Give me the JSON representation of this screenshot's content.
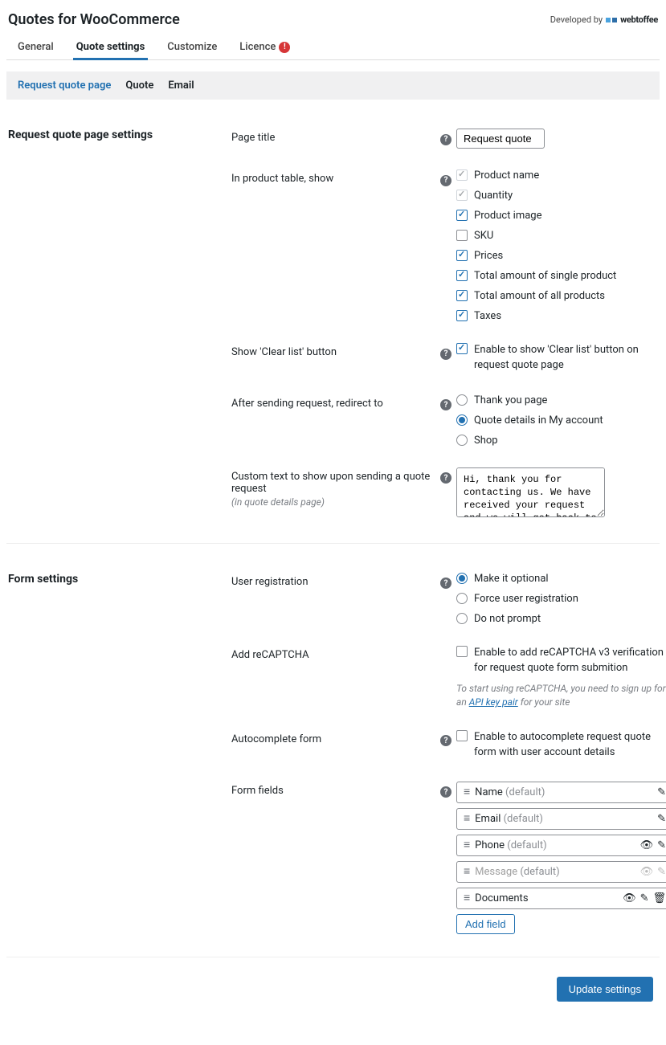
{
  "header": {
    "title": "Quotes for WooCommerce",
    "developed_by": "Developed by",
    "brand": "webtoffee"
  },
  "tabs": [
    {
      "label": "General",
      "active": false
    },
    {
      "label": "Quote settings",
      "active": true
    },
    {
      "label": "Customize",
      "active": false
    },
    {
      "label": "Licence",
      "active": false,
      "alert": "!"
    }
  ],
  "subtabs": [
    {
      "label": "Request quote page",
      "active": true
    },
    {
      "label": "Quote",
      "active": false
    },
    {
      "label": "Email",
      "active": false
    }
  ],
  "section1": {
    "heading": "Request quote page settings",
    "page_title_label": "Page title",
    "page_title_value": "Request quote",
    "product_table_label": "In product table, show",
    "product_table_items": [
      {
        "label": "Product name",
        "checked": true,
        "locked": true
      },
      {
        "label": "Quantity",
        "checked": true,
        "locked": true
      },
      {
        "label": "Product image",
        "checked": true,
        "locked": false
      },
      {
        "label": "SKU",
        "checked": false,
        "locked": false
      },
      {
        "label": "Prices",
        "checked": true,
        "locked": false
      },
      {
        "label": "Total amount of single product",
        "checked": true,
        "locked": false
      },
      {
        "label": "Total amount of all products",
        "checked": true,
        "locked": false
      },
      {
        "label": "Taxes",
        "checked": true,
        "locked": false
      }
    ],
    "clear_list_label": "Show 'Clear list' button",
    "clear_list_chk": {
      "checked": true,
      "label": "Enable to show 'Clear list' button on request quote page"
    },
    "redirect_label": "After sending request, redirect to",
    "redirect_opts": [
      {
        "label": "Thank you page",
        "checked": false
      },
      {
        "label": "Quote details in My account",
        "checked": true
      },
      {
        "label": "Shop",
        "checked": false
      }
    ],
    "custom_text_label": "Custom text to show upon sending a quote request",
    "custom_text_sub": "(in quote details page)",
    "custom_text_value": "Hi, thank you for contacting us. We have received your request and we will get back to you soon."
  },
  "section2": {
    "heading": "Form settings",
    "user_reg_label": "User registration",
    "user_reg_opts": [
      {
        "label": "Make it optional",
        "checked": true
      },
      {
        "label": "Force user registration",
        "checked": false
      },
      {
        "label": "Do not prompt",
        "checked": false
      }
    ],
    "recaptcha_label": "Add reCAPTCHA",
    "recaptcha_chk": {
      "checked": false,
      "label": "Enable to add reCAPTCHA v3 verification for request quote form submition"
    },
    "recaptcha_note_pre": "To start using reCAPTCHA, you need to sign up for an ",
    "recaptcha_note_link": "API key pair",
    "recaptcha_note_post": " for your site",
    "autocomplete_label": "Autocomplete form",
    "autocomplete_chk": {
      "checked": false,
      "label": "Enable to autocomplete request quote form with user account details"
    },
    "form_fields_label": "Form fields",
    "form_fields": [
      {
        "name": "Name",
        "default": true,
        "icons": [
          "edit"
        ],
        "muted": false
      },
      {
        "name": "Email",
        "default": true,
        "icons": [
          "edit"
        ],
        "muted": false
      },
      {
        "name": "Phone",
        "default": true,
        "icons": [
          "eye",
          "edit"
        ],
        "muted": false
      },
      {
        "name": "Message",
        "default": true,
        "icons": [
          "eye-off",
          "edit-off"
        ],
        "muted": true
      },
      {
        "name": "Documents",
        "default": false,
        "icons": [
          "eye",
          "edit",
          "trash"
        ],
        "muted": false
      }
    ],
    "add_field_label": "Add field",
    "default_suffix": " (default)"
  },
  "footer": {
    "update": "Update settings"
  }
}
